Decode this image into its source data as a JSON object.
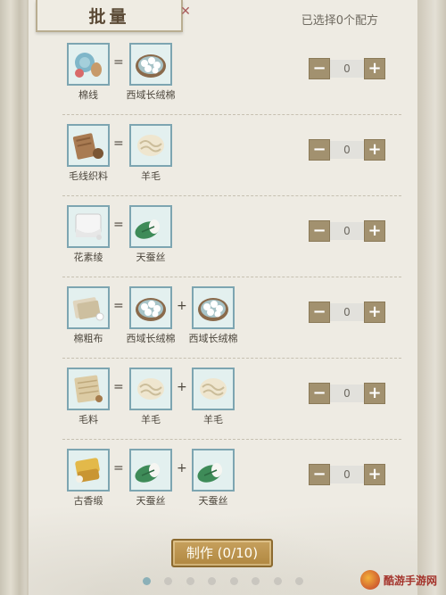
{
  "header": {
    "title": "批量",
    "selected_text": "已选择0个配方"
  },
  "recipes": [
    {
      "product": {
        "label": "棉线",
        "icon": "cotton-thread-icon"
      },
      "ops": [
        "="
      ],
      "ingredients": [
        {
          "label": "西域长绒棉",
          "icon": "cotton-bolls-icon"
        }
      ],
      "qty": "0"
    },
    {
      "product": {
        "label": "毛线织料",
        "icon": "wool-fabric-icon"
      },
      "ops": [
        "="
      ],
      "ingredients": [
        {
          "label": "羊毛",
          "icon": "wool-icon"
        }
      ],
      "qty": "0"
    },
    {
      "product": {
        "label": "花素绫",
        "icon": "silk-cloth-icon"
      },
      "ops": [
        "="
      ],
      "ingredients": [
        {
          "label": "天蚕丝",
          "icon": "silkworm-cocoon-icon"
        }
      ],
      "qty": "0"
    },
    {
      "product": {
        "label": "棉粗布",
        "icon": "cotton-cloth-icon"
      },
      "ops": [
        "=",
        "+"
      ],
      "ingredients": [
        {
          "label": "西域长绒棉",
          "icon": "cotton-bolls-icon"
        },
        {
          "label": "西域长绒棉",
          "icon": "cotton-bolls-icon"
        }
      ],
      "qty": "0"
    },
    {
      "product": {
        "label": "毛料",
        "icon": "wool-cloth-icon"
      },
      "ops": [
        "=",
        "+"
      ],
      "ingredients": [
        {
          "label": "羊毛",
          "icon": "wool-icon"
        },
        {
          "label": "羊毛",
          "icon": "wool-icon"
        }
      ],
      "qty": "0"
    },
    {
      "product": {
        "label": "古香缎",
        "icon": "satin-roll-icon"
      },
      "ops": [
        "=",
        "+"
      ],
      "ingredients": [
        {
          "label": "天蚕丝",
          "icon": "silkworm-cocoon-icon"
        },
        {
          "label": "天蚕丝",
          "icon": "silkworm-cocoon-icon"
        }
      ],
      "qty": "0"
    }
  ],
  "stepper": {
    "minus": "−",
    "plus": "+"
  },
  "make_button": "制作 (0/10)",
  "pagination": {
    "total": 8,
    "active": 0
  },
  "watermark": "酷游手游网",
  "colors": {
    "accent": "#a2916f",
    "icon_border": "#7da5b1",
    "button": "#b08740"
  }
}
